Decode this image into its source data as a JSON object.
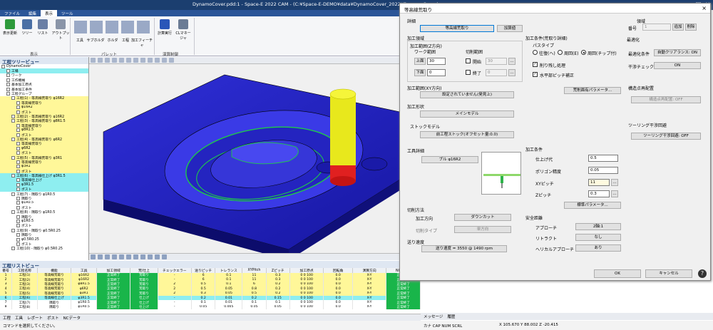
{
  "window": {
    "title": "DynamoCover.pdd:1 - Space-E 2022 CAM - (C:¥Space-E-DEMO¥data¥DynamoCover_2022¥DynamoCover)"
  },
  "menu": [
    "ファイル",
    "編集",
    "表示",
    "ツール"
  ],
  "ribbon": {
    "buttons": [
      "表示更新",
      "ツリー",
      "リスト",
      "アウトプット",
      "工具",
      "サブホルダ",
      "ホルダ",
      "工程",
      "加工フィーチャ",
      "計算実行",
      "CLマネージャ"
    ],
    "groups": [
      "表示",
      "パレット",
      "演算制御"
    ]
  },
  "tree": {
    "header": "工程ツリービュー",
    "nodes": [
      {
        "t": "DynamoCover",
        "cls": "",
        "ind": 0
      },
      {
        "t": "工場",
        "cls": "c",
        "ind": 1
      },
      {
        "t": "ワーク",
        "cls": "",
        "ind": 1
      },
      {
        "t": "工作機械",
        "cls": "",
        "ind": 1
      },
      {
        "t": "基本加工原点",
        "cls": "",
        "ind": 1
      },
      {
        "t": "基本加工条件",
        "cls": "",
        "ind": 1
      },
      {
        "t": "工程グループ",
        "cls": "",
        "ind": 1
      },
      {
        "t": "工程(1) - 等高線荒取り φ16R2",
        "cls": "y",
        "ind": 2
      },
      {
        "t": "等高線荒取り",
        "cls": "y",
        "ind": 3
      },
      {
        "t": "φ16R2",
        "cls": "y",
        "ind": 3
      },
      {
        "t": "ポスト",
        "cls": "y",
        "ind": 3
      },
      {
        "t": "工程(2) - 等高線荒取り φ16R2",
        "cls": "y",
        "ind": 2
      },
      {
        "t": "工程(3) - 等高線荒取り φ8R1.5",
        "cls": "y",
        "ind": 2
      },
      {
        "t": "等高線荒取り",
        "cls": "y",
        "ind": 3
      },
      {
        "t": "φ8R1.5",
        "cls": "y",
        "ind": 3
      },
      {
        "t": "ポスト",
        "cls": "y",
        "ind": 3
      },
      {
        "t": "工程(4) - 等高線荒取り φ6R2",
        "cls": "y",
        "ind": 2
      },
      {
        "t": "等高線荒取り",
        "cls": "y",
        "ind": 3
      },
      {
        "t": "φ6R2",
        "cls": "y",
        "ind": 3
      },
      {
        "t": "ポスト",
        "cls": "y",
        "ind": 3
      },
      {
        "t": "工程(5) - 等高線荒取り φ3R1",
        "cls": "y",
        "ind": 2
      },
      {
        "t": "等高線荒取り",
        "cls": "y",
        "ind": 3
      },
      {
        "t": "φ3R1",
        "cls": "y",
        "ind": 3
      },
      {
        "t": "ポスト",
        "cls": "y",
        "ind": 3
      },
      {
        "t": "工程(6) - 等高線仕上げ φ3R1.5",
        "cls": "c",
        "ind": 2
      },
      {
        "t": "等高線仕上げ",
        "cls": "c",
        "ind": 3
      },
      {
        "t": "φ3R1.5",
        "cls": "c",
        "ind": 3
      },
      {
        "t": "ポスト",
        "cls": "c",
        "ind": 3
      },
      {
        "t": "工程(7) - 隅取り φ1R0.5",
        "cls": "",
        "ind": 2
      },
      {
        "t": "隅取り",
        "cls": "",
        "ind": 3
      },
      {
        "t": "φ1R0.5",
        "cls": "",
        "ind": 3
      },
      {
        "t": "ポスト",
        "cls": "",
        "ind": 3
      },
      {
        "t": "工程(8) - 隅取り φ1R0.5",
        "cls": "",
        "ind": 2
      },
      {
        "t": "隅取り",
        "cls": "",
        "ind": 3
      },
      {
        "t": "φ1R0.5",
        "cls": "",
        "ind": 3
      },
      {
        "t": "ポスト",
        "cls": "",
        "ind": 3
      },
      {
        "t": "工程(9) - 隅取り φ0.5R0.25",
        "cls": "",
        "ind": 2
      },
      {
        "t": "隅取り",
        "cls": "",
        "ind": 3
      },
      {
        "t": "φ0.5R0.25",
        "cls": "",
        "ind": 3
      },
      {
        "t": "ポスト",
        "cls": "",
        "ind": 3
      },
      {
        "t": "工程(10) - 隅取り φ0.5R0.25",
        "cls": "",
        "ind": 2
      }
    ]
  },
  "list": {
    "header": "工程リストビュー",
    "columns": [
      "番号",
      "工程名称",
      "機能",
      "工具",
      "加工領域",
      "荒/仕上",
      "チェックエラー",
      "送りピッチ",
      "トレランス",
      "XYPitch",
      "Zピッチ",
      "加工原点",
      "回転角",
      "演算方向",
      "NCデータ"
    ],
    "rows": [
      [
        "1",
        "工程(1)",
        "等高線荒取り",
        "φ16R2",
        "正常終了",
        "荒取り",
        "-",
        "6",
        "0.1",
        "11",
        "0.3",
        "0 0 100",
        "0.0",
        "X-Y",
        "正常終了"
      ],
      [
        "2",
        "工程(2)",
        "等高線荒取り",
        "φ16R2",
        "正常終了",
        "荒取り",
        "-",
        "6",
        "0.1",
        "11",
        "0.3",
        "0 0 100",
        "0.0",
        "X-Y",
        "正常終了"
      ],
      [
        "3",
        "工程(3)",
        "等高線荒取り",
        "φ8R1.5",
        "正常終了",
        "荒取り",
        "2",
        "0.5",
        "0.1",
        "6",
        "0.2",
        "0 0 100",
        "0.0",
        "X-Y",
        "正常終了"
      ],
      [
        "4",
        "工程(4)",
        "等高線荒取り",
        "φ6R2",
        "正常終了",
        "荒取り",
        "2",
        "0.5",
        "0.05",
        "0.8",
        "0.2",
        "0 0 100",
        "0.0",
        "X-Y",
        "正常終了"
      ],
      [
        "5",
        "工程(5)",
        "等高線荒取り",
        "φ3R1",
        "正常終了",
        "荒取り",
        "2",
        "0.3",
        "0.05",
        "0.5",
        "0.2",
        "0 0 100",
        "0.0",
        "X-Y",
        "正常終了"
      ],
      [
        "6",
        "工程(6)",
        "等高線仕上げ",
        "φ3R1.5",
        "正常終了",
        "仕上げ",
        "-",
        "0.2",
        "0.01",
        "0.2",
        "0.15",
        "0 0 100",
        "0.0",
        "X-Y",
        "正常終了"
      ],
      [
        "7",
        "工程(7)",
        "隅取り",
        "φ1R0.5",
        "正常終了",
        "仕上げ",
        "-",
        "0.1",
        "0.01",
        "0.1",
        "0.1",
        "0 0 100",
        "0.0",
        "X-Y",
        "正常終了"
      ],
      [
        "8",
        "工程(8)",
        "隅取り",
        "φ1R0.5",
        "正常終了",
        "仕上げ",
        "-",
        "0.05",
        "0.005",
        "0.05",
        "0.05",
        "0 0 100",
        "0.0",
        "X-Y",
        "正常終了"
      ]
    ]
  },
  "tabs": [
    "工程",
    "工具",
    "レポート",
    "ポスト",
    "NCデータ"
  ],
  "status": "コマンドを選択してください。",
  "dialog": {
    "title": "等高線荒取り",
    "sections": {
      "shosai": "詳細",
      "kako_ryoiki": "加工領域",
      "kako_joken": "加工条件(荒取り詳細)",
      "saiteki": "最適化",
      "kogu_settei": "工具詳細",
      "sessaku_hoho": "切削方法",
      "kako_joken2": "加工条件",
      "anzen": "安全距離",
      "ryoiki": "領域",
      "sokudo": "送り速度"
    },
    "top_buttons": {
      "mode": "等高線荒取り",
      "param": "加算値"
    },
    "right_top": {
      "label": "番号",
      "value": "1",
      "add": "追加",
      "del": "削除"
    },
    "work": {
      "title": "加工範囲(Z方向)",
      "sub": "ワーク範囲",
      "upper_label": "上面",
      "upper_val": "30",
      "lower_label": "下面",
      "lower_val": "0",
      "cut_title": "切削範囲",
      "start_label": "開始",
      "start_val": "30",
      "end_label": "終了",
      "end_val": "0"
    },
    "xy": {
      "title": "加工範囲(XY方向)",
      "btn": "設定されていません(発見上)"
    },
    "shape": {
      "title": "加工形状",
      "btn": "メインモデル"
    },
    "stock": {
      "title": "ストックモデル",
      "btn": "前工程ストック(オフセット量:0.0)"
    },
    "tool": {
      "btn": "ブル φ16R2"
    },
    "pass": {
      "title": "パスタイプ",
      "opts": [
        "往復(ヘ)",
        "周回(E)",
        "周回(チップ付)"
      ],
      "chk1": "削り残し処理",
      "chk2": "水平部ピッチ補正",
      "btn": "荒削面有パラメータ..."
    },
    "params": [
      {
        "k": "仕上げ代",
        "v": "0.5"
      },
      {
        "k": "ポリゴン精度",
        "v": "0.05"
      },
      {
        "k": "XYピッチ",
        "v": "11"
      },
      {
        "k": "Zピッチ",
        "v": "0.3"
      }
    ],
    "param_btn": "標準パラメータ...",
    "cut": {
      "dir_label": "加工方向",
      "dir_btn": "ダウンカット",
      "type_label": "切削タイプ",
      "type_btn": "単方向"
    },
    "safe": [
      {
        "k": "アプローチ",
        "v": "2軸:1"
      },
      {
        "k": "リトラクト",
        "v": "なし"
      },
      {
        "k": "ヘリカルアプローチ",
        "v": "あり"
      }
    ],
    "feed_btn": "送り速度 = 3550 @ 1490 rpm",
    "opt": [
      {
        "k": "最適化条件",
        "v": "自動クリアランス: ON"
      },
      {
        "k": "干渉チェック",
        "v": "ON"
      }
    ],
    "extra": {
      "t1": "構造点再配置",
      "b1": "構造点再配置: OFF",
      "t2": "ツーリング干渉回避",
      "b2": "ツーリング干渉回避: OFF"
    },
    "ok": "OK",
    "cancel": "キャンセル"
  },
  "message_tab": "メッセージ",
  "message_tab2": "履歴",
  "coords": "X 105.670 Y 88.002 Z -20.415",
  "kbd": "カナ CAP NUM SCRL"
}
